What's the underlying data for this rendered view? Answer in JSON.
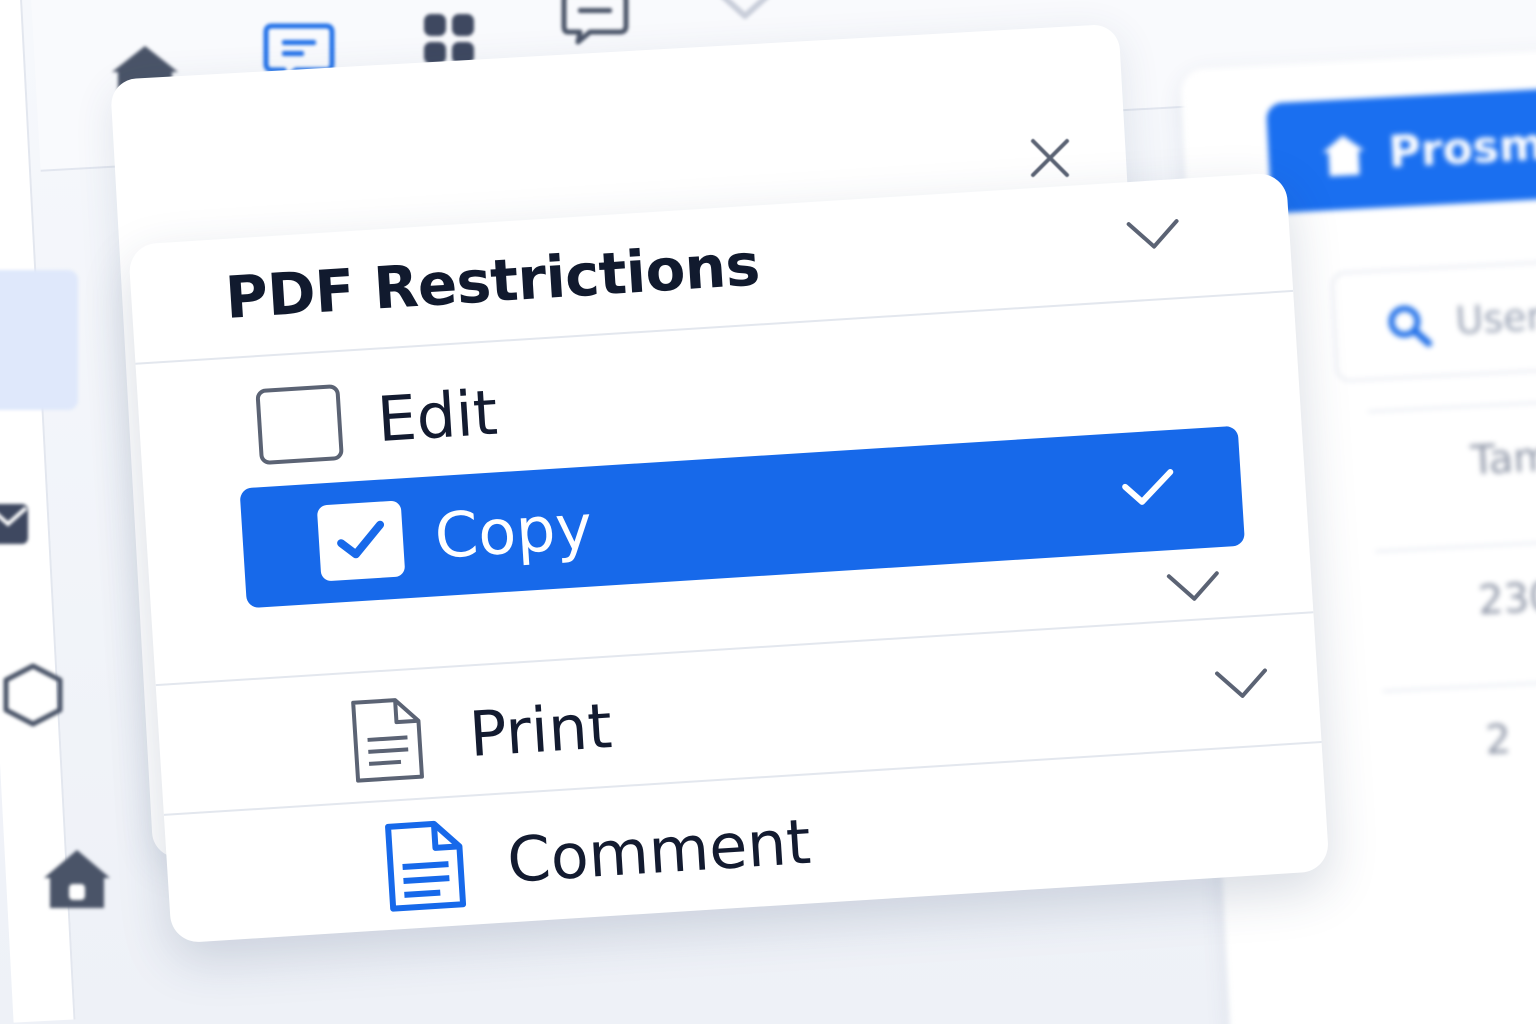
{
  "toolbar": {
    "icons": [
      "home-icon",
      "chat-bubble-icon",
      "grid-icon",
      "message-icon",
      "shield-icon"
    ]
  },
  "sidebar": {
    "icons": [
      "mail-icon",
      "hexagon-icon",
      "home-icon"
    ]
  },
  "dialog": {
    "close_icon": "close-icon"
  },
  "restrictions": {
    "title": "PDF Restrictions",
    "options": [
      {
        "label": "Edit",
        "checked": false,
        "selected": false,
        "lead": "checkbox"
      },
      {
        "label": "Copy",
        "checked": true,
        "selected": true,
        "lead": "checkbox"
      },
      {
        "label": "Print",
        "checked": false,
        "selected": false,
        "lead": "document-icon"
      },
      {
        "label": "Comment",
        "checked": false,
        "selected": false,
        "lead": "document-blue-icon"
      }
    ]
  },
  "right_panel": {
    "primary_button_label": "Prosm",
    "search_placeholder": "User",
    "rows": [
      "Tamm",
      "230",
      "2"
    ]
  },
  "colors": {
    "accent": "#1769ea",
    "text": "#131b30",
    "icon_gray": "#4a5468",
    "background": "#eef1f7"
  }
}
